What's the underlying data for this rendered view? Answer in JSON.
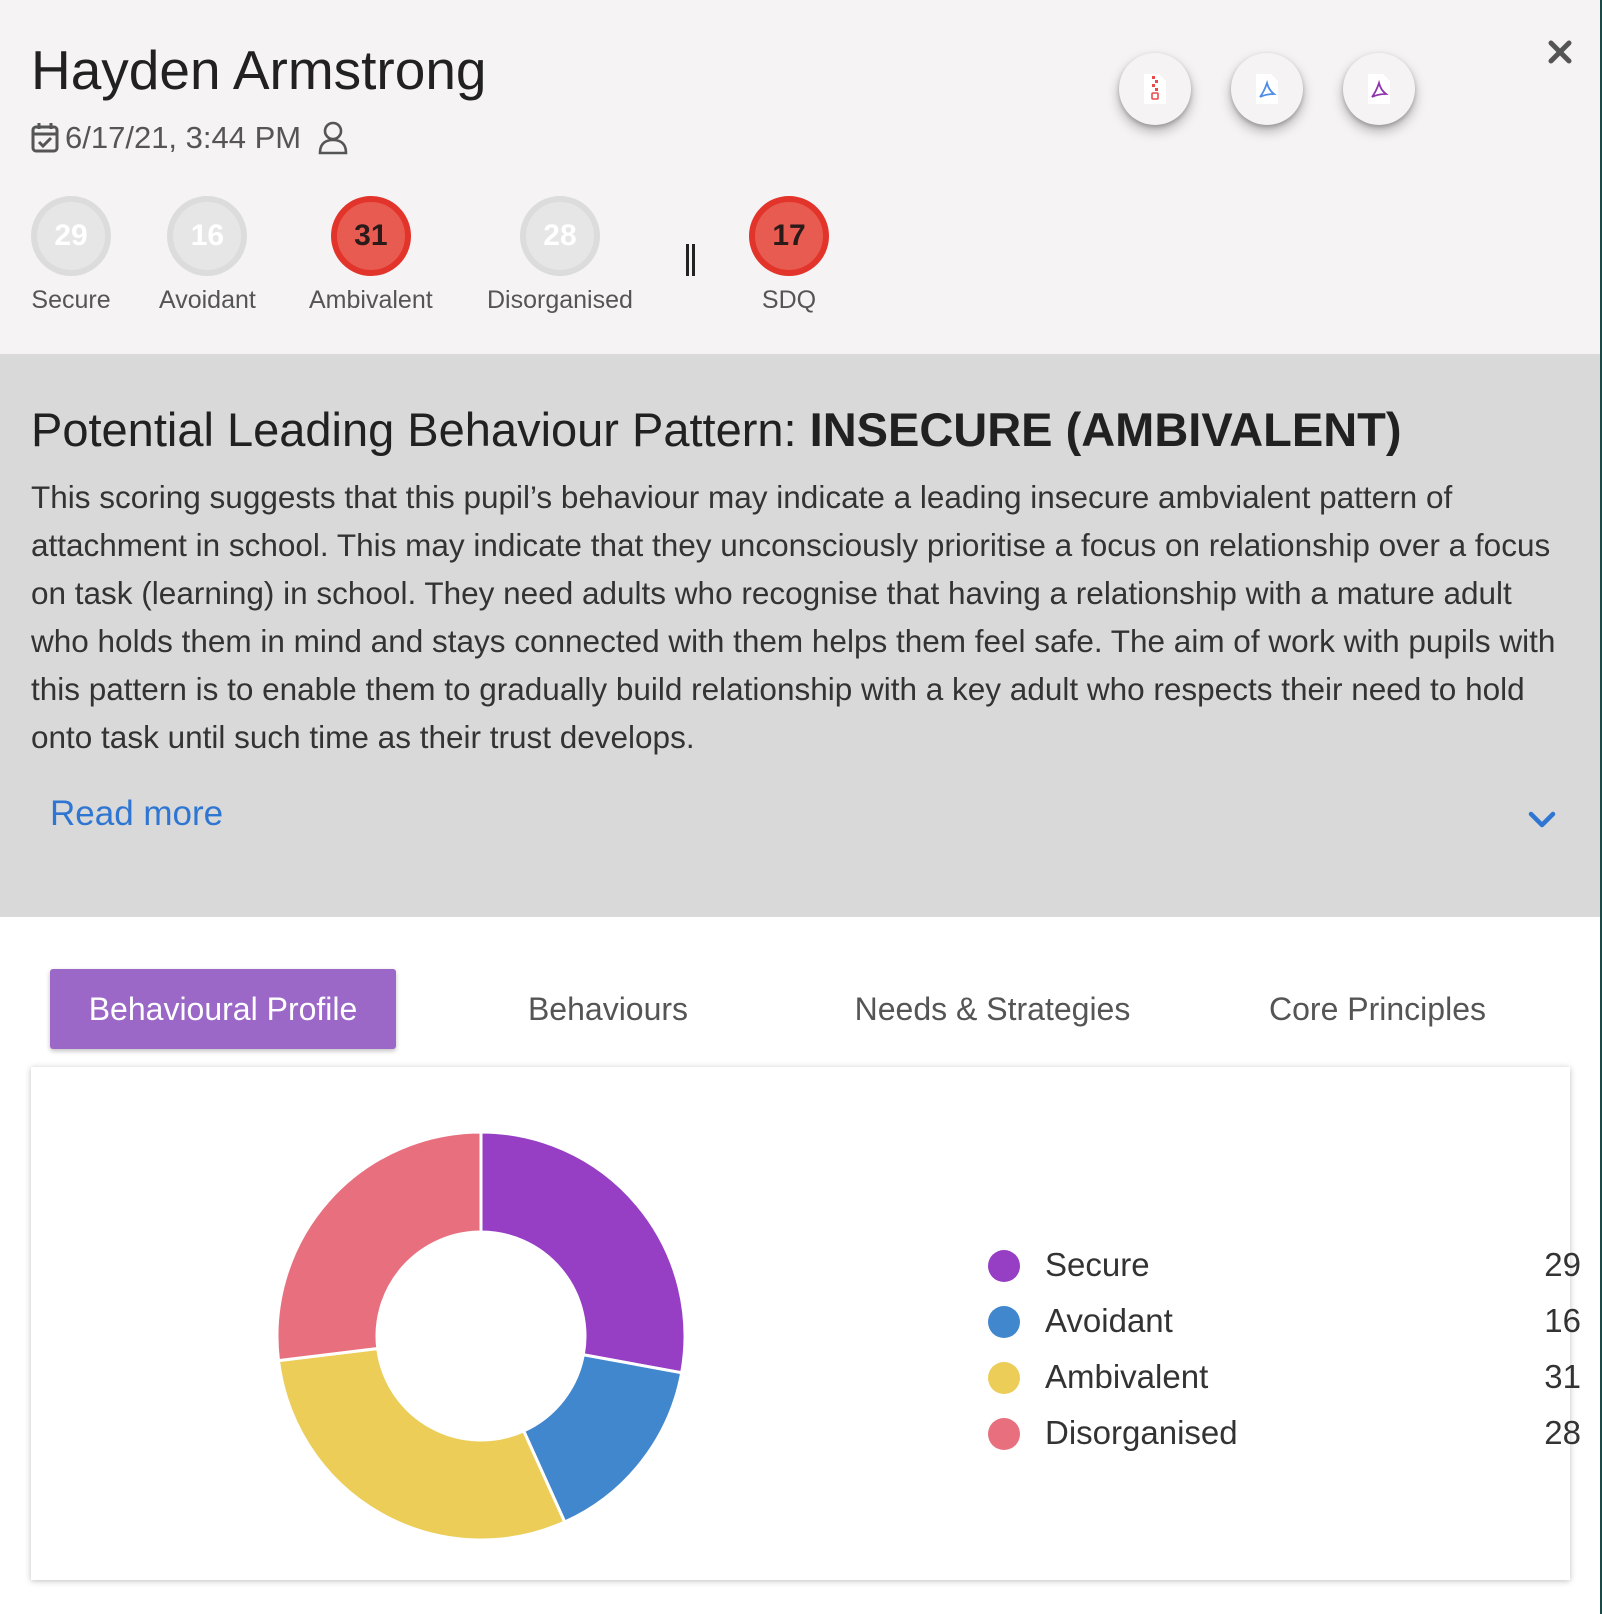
{
  "student": {
    "name": "Hayden Armstrong",
    "date": "6/17/21, 3:44 PM"
  },
  "actions": [
    {
      "name": "zip-download-button",
      "icon": "zip-file-icon",
      "color": "#e94b4b"
    },
    {
      "name": "pdf-download-button",
      "icon": "pdf-file-icon",
      "color": "#4f8ce8"
    },
    {
      "name": "pdf-report-button",
      "icon": "pdf-file-icon",
      "color": "#8e34ad"
    }
  ],
  "scores": [
    {
      "label": "Secure",
      "value": "29",
      "highlight": false
    },
    {
      "label": "Avoidant",
      "value": "16",
      "highlight": false
    },
    {
      "label": "Ambivalent",
      "value": "31",
      "highlight": true
    },
    {
      "label": "Disorganised",
      "value": "28",
      "highlight": false
    },
    {
      "label": "SDQ",
      "value": "17",
      "highlight": true
    }
  ],
  "pattern": {
    "title_prefix": "Potential Leading Behaviour Pattern: ",
    "title_value": "INSECURE (AMBIVALENT)",
    "description": "This scoring suggests that this pupil’s behaviour may indicate a leading insecure ambvialent pattern of attachment in school. This may indicate that they unconsciously prioritise a focus on relationship over a focus on task (learning) in school. They need adults who recognise that having a relationship with a mature adult who holds them in mind and stays connected with them helps them feel safe. The aim of work with pupils with this pattern is to enable them to gradually build relationship with a key adult who respects their need to hold onto task until such time as their trust develops.",
    "read_more": "Read more"
  },
  "tabs": [
    {
      "label": "Behavioural Profile",
      "active": true
    },
    {
      "label": "Behaviours",
      "active": false
    },
    {
      "label": "Needs & Strategies",
      "active": false
    },
    {
      "label": "Core Principles",
      "active": false
    }
  ],
  "chart_data": {
    "type": "pie",
    "donut": true,
    "categories": [
      "Secure",
      "Avoidant",
      "Ambivalent",
      "Disorganised"
    ],
    "values": [
      29,
      16,
      31,
      28
    ],
    "colors": [
      "#963fc5",
      "#4187cd",
      "#ebcd58",
      "#e8707e"
    ],
    "legend": "right"
  },
  "colors": {
    "accent": "#9b68c8",
    "link": "#2f76d2",
    "highlight": "#e2342a"
  }
}
